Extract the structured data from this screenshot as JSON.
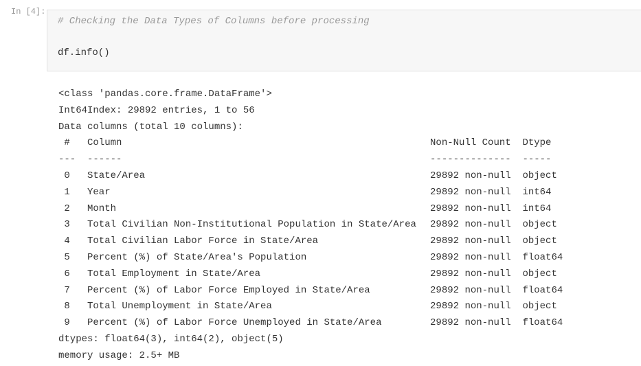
{
  "prompt": "In [4]:",
  "code": {
    "comment": "# Checking the Data Types of Columns before processing",
    "statement": "df.info()"
  },
  "output": {
    "header_lines": [
      "<class 'pandas.core.frame.DataFrame'>",
      "Int64Index: 29892 entries, 1 to 56",
      "Data columns (total 10 columns):"
    ],
    "table_header": [
      "#",
      "Column",
      "Non-Null Count",
      "Dtype"
    ],
    "table_separator": [
      "---",
      "------",
      "--------------",
      "-----"
    ],
    "rows": [
      [
        "0",
        "State/Area",
        "29892 non-null",
        "object"
      ],
      [
        "1",
        "Year",
        "29892 non-null",
        "int64"
      ],
      [
        "2",
        "Month",
        "29892 non-null",
        "int64"
      ],
      [
        "3",
        "Total Civilian Non-Institutional Population in State/Area",
        "29892 non-null",
        "object"
      ],
      [
        "4",
        "Total Civilian Labor Force in State/Area",
        "29892 non-null",
        "object"
      ],
      [
        "5",
        "Percent (%) of State/Area's Population",
        "29892 non-null",
        "float64"
      ],
      [
        "6",
        "Total Employment in State/Area",
        "29892 non-null",
        "object"
      ],
      [
        "7",
        "Percent (%) of Labor Force Employed in State/Area",
        "29892 non-null",
        "float64"
      ],
      [
        "8",
        "Total Unemployment in State/Area",
        "29892 non-null",
        "object"
      ],
      [
        "9",
        "Percent (%) of Labor Force Unemployed in State/Area",
        "29892 non-null",
        "float64"
      ]
    ],
    "footer_lines": [
      "dtypes: float64(3), int64(2), object(5)",
      "memory usage: 2.5+ MB"
    ]
  }
}
